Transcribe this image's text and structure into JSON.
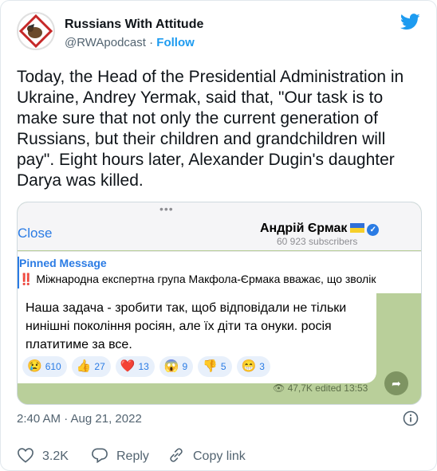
{
  "tweet": {
    "author_name": "Russians With Attitude",
    "handle": "@RWApodcast",
    "separator": "·",
    "follow_label": "Follow",
    "text": "Today, the Head of the Presidential Administration in Ukraine, Andrey Yermak, said that, \"Our task is to make sure that not only the current generation of Russians, but their children and grandchildren will pay\". Eight hours later, Alexander Dugin's daughter Darya was killed.",
    "timestamp": "2:40 AM · Aug 21, 2022",
    "likes": "3.2K",
    "reply_label": "Reply",
    "copy_link_label": "Copy link"
  },
  "telegram": {
    "drag_dots": "•••",
    "close_label": "Close",
    "channel_name": "Андрій Єрмак",
    "subscribers": "60 923 subscribers",
    "pinned_title": "Pinned Message",
    "pinned_text": "‼️ Міжнародна експертна група Макфола-Єрмака вважає, що зволік",
    "message": "Наша задача - зробити так, щоб відповідали не тільки нинішні покоління росіян, але їх діти та онуки. росія платитиме за все.",
    "reactions": [
      {
        "emoji": "😢",
        "count": "610"
      },
      {
        "emoji": "👍",
        "count": "27"
      },
      {
        "emoji": "❤️",
        "count": "13"
      },
      {
        "emoji": "😱",
        "count": "9"
      },
      {
        "emoji": "👎",
        "count": "5"
      },
      {
        "emoji": "😁",
        "count": "3"
      }
    ],
    "views": "47,7K",
    "edited": "edited 13:53"
  },
  "colors": {
    "accent": "#1d9bf0",
    "telegram_blue": "#2a7be4",
    "chat_background": "#b9cf9a",
    "muted_text": "#536471"
  },
  "icons": {
    "brand": "twitter-bird-icon",
    "verified": "verified-badge-icon",
    "flag": "ukraine-flag-icon",
    "share": "share-arrow-icon",
    "info": "info-icon",
    "like": "heart-icon",
    "reply": "reply-bubble-icon",
    "copy": "link-icon"
  }
}
